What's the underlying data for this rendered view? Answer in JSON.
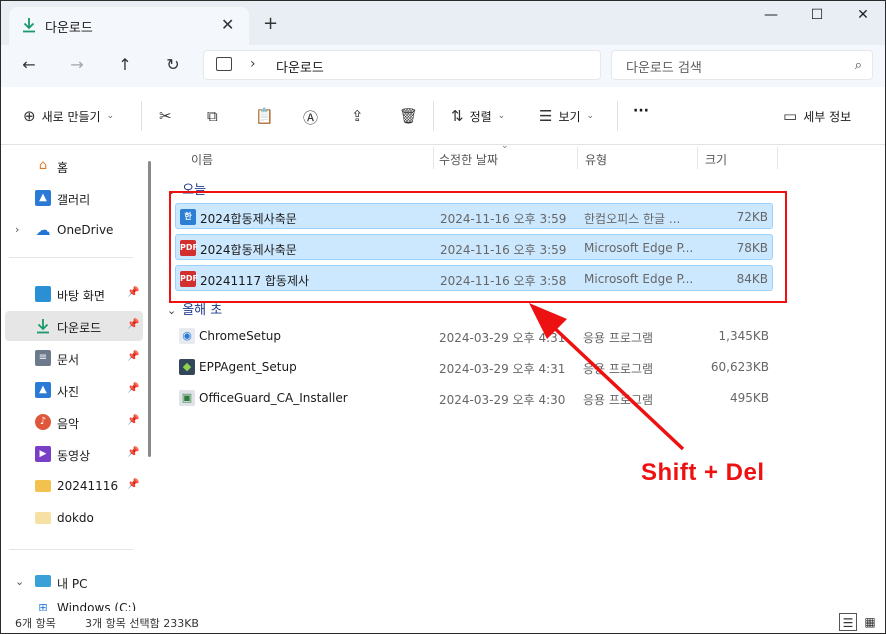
{
  "window": {
    "tab_title": "다운로드",
    "tab_close": "✕",
    "new_tab": "+",
    "minimize": "—",
    "maximize": "☐",
    "close": "✕"
  },
  "nav": {
    "back": "←",
    "forward": "→",
    "up": "↑",
    "refresh": "↻",
    "breadcrumb_sep": "›",
    "breadcrumb": "다운로드",
    "search_placeholder": "다운로드 검색",
    "search_icon": "⌕"
  },
  "toolbar": {
    "new_label": "새로 만들기",
    "sort_label": "정렬",
    "view_label": "보기",
    "more_label": "···",
    "details_label": "세부 정보",
    "cut_icon": "✂",
    "copy_icon": "⧉",
    "paste_icon": "📋",
    "rename_icon": "Ⓐ",
    "share_icon": "⇪",
    "delete_icon": "🗑"
  },
  "sidebar": {
    "items": [
      {
        "label": "홈"
      },
      {
        "label": "갤러리"
      },
      {
        "label": "OneDrive"
      },
      {
        "label": "바탕 화면"
      },
      {
        "label": "다운로드"
      },
      {
        "label": "문서"
      },
      {
        "label": "사진"
      },
      {
        "label": "음악"
      },
      {
        "label": "동영상"
      },
      {
        "label": "20241116"
      },
      {
        "label": "dokdo"
      },
      {
        "label": "내 PC"
      },
      {
        "label": "Windows (C:)"
      }
    ]
  },
  "columns": {
    "name": "이름",
    "modified": "수정한 날짜",
    "type": "유형",
    "size": "크기"
  },
  "groups": {
    "today": "오늘",
    "this_year": "올해 초"
  },
  "files": [
    {
      "name": "2024합동제사축문",
      "date": "2024-11-16 오후 3:59",
      "type": "한컴오피스 한글 ...",
      "size": "72KB"
    },
    {
      "name": "2024합동제사축문",
      "date": "2024-11-16 오후 3:59",
      "type": "Microsoft Edge P...",
      "size": "78KB"
    },
    {
      "name": "20241117 합동제사",
      "date": "2024-11-16 오후 3:58",
      "type": "Microsoft Edge P...",
      "size": "84KB"
    },
    {
      "name": "ChromeSetup",
      "date": "2024-03-29 오후 4:31",
      "type": "응용 프로그램",
      "size": "1,345KB"
    },
    {
      "name": "EPPAgent_Setup",
      "date": "2024-03-29 오후 4:31",
      "type": "응용 프로그램",
      "size": "60,623KB"
    },
    {
      "name": "OfficeGuard_CA_Installer",
      "date": "2024-03-29 오후 4:30",
      "type": "응용 프로그램",
      "size": "495KB"
    }
  ],
  "icons": {
    "pdf": "PDF"
  },
  "annotation": {
    "text": "Shift + Del",
    "color": "#ee1111"
  },
  "status": {
    "count": "6개 항목",
    "selected": "3개 항목 선택함 233KB"
  }
}
